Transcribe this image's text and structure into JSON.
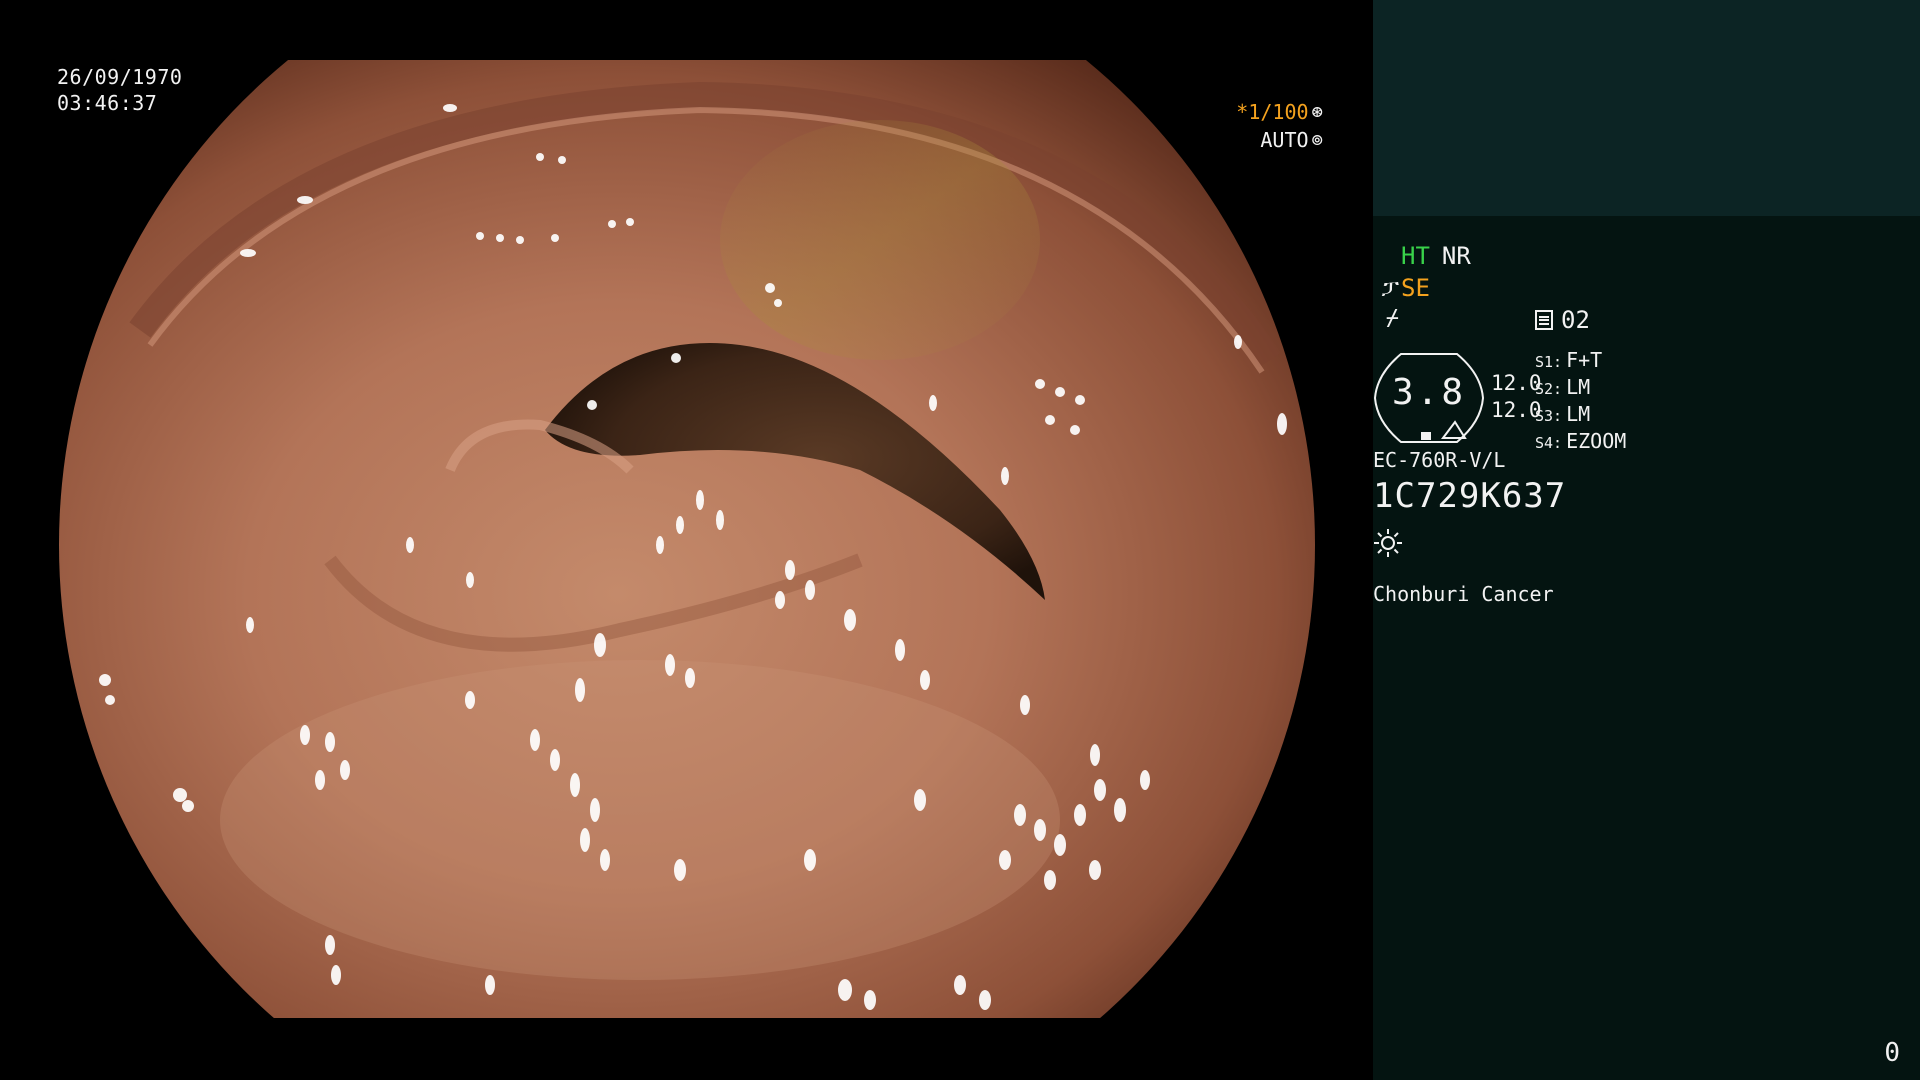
{
  "image": {
    "date": "26/09/1970",
    "time": "03:46:37",
    "shutter": "*1/100",
    "shutter_icon": "aperture-icon",
    "iris_mode": "AUTO",
    "iris_icon": "iris-icon"
  },
  "panel": {
    "structure_enhance": "HT",
    "noise_reduction": "NR",
    "color_enhance": "SE",
    "color_enhance_icon": "scope-tip-icon",
    "freeze_icon": "freeze-icon",
    "doc_icon": "document-icon",
    "doc_count": "02",
    "zoom_value": "3.8",
    "zoom_level_a": "12.0",
    "zoom_level_b": "12.0",
    "slots": [
      {
        "key": "S1:",
        "value": "F+T"
      },
      {
        "key": "S2:",
        "value": "LM"
      },
      {
        "key": "S3:",
        "value": "LM"
      },
      {
        "key": "S4:",
        "value": "EZOOM"
      }
    ],
    "scope_model": "EC-760R-V/L",
    "scope_serial": "1C729K637",
    "light_icon": "light-source-icon",
    "hospital": "Chonburi Cancer",
    "counter": "0"
  },
  "colors": {
    "orange": "#f4a21e",
    "green": "#39d24a",
    "panel_top": "#0c2424",
    "panel_bg": "#041411",
    "mucosa": "#b0755a"
  }
}
